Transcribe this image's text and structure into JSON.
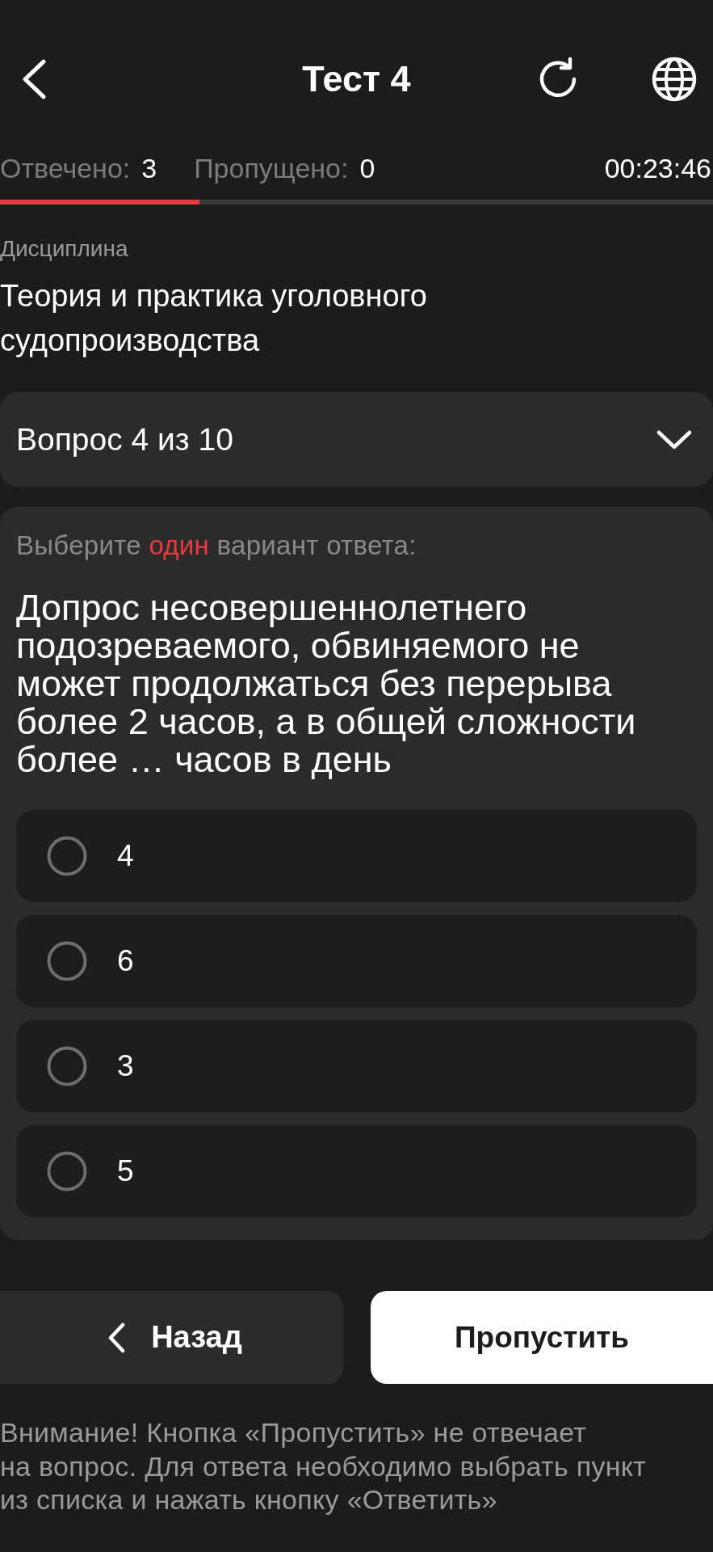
{
  "header": {
    "title": "Тест 4"
  },
  "stats": {
    "answered_label": "Отвечено:",
    "answered_value": "3",
    "skipped_label": "Пропущено:",
    "skipped_value": "0",
    "timer": "00:23:46"
  },
  "progress": {
    "level": 0.28
  },
  "discipline": {
    "label": "Дисциплина",
    "name_lines": [
      "Теория и практика уголовного",
      "судопроизводства"
    ]
  },
  "question_picker": {
    "label": "Вопрос 4 из 10",
    "expanded": false
  },
  "question": {
    "instruction": {
      "before": "Выберите",
      "highlight": "один",
      "after": "вариант ответа:"
    },
    "text": "Допрос несовершеннолетнего подозреваемого, обвиняемого не может продолжаться без перерыва более 2 часов, а в общей сложности более … часов в день"
  },
  "options": [
    {
      "label": "4",
      "selected": false
    },
    {
      "label": "6",
      "selected": false
    },
    {
      "label": "3",
      "selected": false
    },
    {
      "label": "5",
      "selected": false
    }
  ],
  "buttons": {
    "back": "Назад",
    "skip": "Пропустить"
  },
  "notice_lines": [
    "Внимание! Кнопка «Пропустить» не отвечает",
    "на вопрос. Для ответа необходимо выбрать пункт",
    "из списка и нажать кнопку «Ответить»"
  ]
}
